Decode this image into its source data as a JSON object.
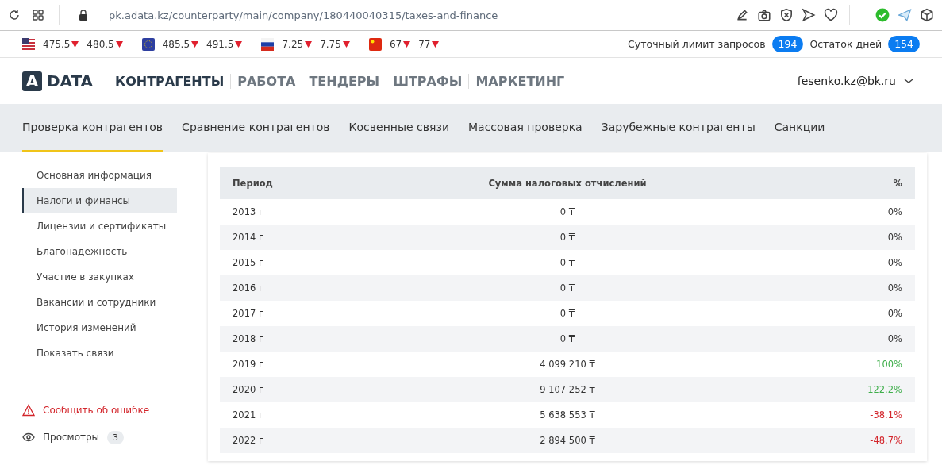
{
  "browser": {
    "url": "pk.adata.kz/counterparty/main/company/180440040315/taxes-and-finance"
  },
  "rates": [
    {
      "kind": "us",
      "values": [
        {
          "value": "475.5",
          "falling": true
        },
        {
          "value": "480.5",
          "falling": true
        }
      ]
    },
    {
      "kind": "eu",
      "values": [
        {
          "value": "485.5",
          "falling": true
        },
        {
          "value": "491.5",
          "falling": true
        }
      ]
    },
    {
      "kind": "ru",
      "values": [
        {
          "value": "7.25",
          "falling": true
        },
        {
          "value": "7.75",
          "falling": true
        }
      ]
    },
    {
      "kind": "cn",
      "values": [
        {
          "value": "67",
          "falling": true
        },
        {
          "value": "77",
          "falling": true
        }
      ]
    }
  ],
  "limits": [
    {
      "label": "Суточный лимит запросов",
      "count": "194"
    },
    {
      "label": "Остаток дней",
      "count": "154"
    }
  ],
  "logo": {
    "mark": "A",
    "text": "DATA"
  },
  "main_nav": [
    {
      "label": "КОНТРАГЕНТЫ",
      "selected": true
    },
    {
      "label": "РАБОТА",
      "selected": false
    },
    {
      "label": "ТЕНДЕРЫ",
      "selected": false
    },
    {
      "label": "ШТРАФЫ",
      "selected": false
    },
    {
      "label": "МАРКЕТИНГ",
      "selected": false
    }
  ],
  "user": {
    "email": "fesenko.kz@bk.ru"
  },
  "sub_nav": [
    {
      "label": "Проверка контрагентов",
      "selected": true
    },
    {
      "label": "Сравнение контрагентов",
      "selected": false
    },
    {
      "label": "Косвенные связи",
      "selected": false
    },
    {
      "label": "Массовая проверка",
      "selected": false
    },
    {
      "label": "Зарубежные контрагенты",
      "selected": false
    },
    {
      "label": "Санкции",
      "selected": false
    }
  ],
  "sidebar": {
    "items": [
      {
        "label": "Основная информация",
        "selected": false
      },
      {
        "label": "Налоги и финансы",
        "selected": true
      },
      {
        "label": "Лицензии и сертификаты",
        "selected": false
      },
      {
        "label": "Благонадежность",
        "selected": false
      },
      {
        "label": "Участие в закупках",
        "selected": false
      },
      {
        "label": "Вакансии и сотрудники",
        "selected": false
      },
      {
        "label": "История изменений",
        "selected": false
      },
      {
        "label": "Показать связи",
        "selected": false
      }
    ],
    "report_error": "Сообщить об ошибке",
    "views": {
      "label": "Просмотры",
      "count": "3"
    }
  },
  "table": {
    "columns": [
      "Период",
      "Сумма налоговых отчислений",
      "%"
    ],
    "rows": [
      {
        "period": "2013 г",
        "amount": "0 ₸",
        "percent": "0%",
        "growth": false,
        "decline": false
      },
      {
        "period": "2014 г",
        "amount": "0 ₸",
        "percent": "0%",
        "growth": false,
        "decline": false
      },
      {
        "period": "2015 г",
        "amount": "0 ₸",
        "percent": "0%",
        "growth": false,
        "decline": false
      },
      {
        "period": "2016 г",
        "amount": "0 ₸",
        "percent": "0%",
        "growth": false,
        "decline": false
      },
      {
        "period": "2017 г",
        "amount": "0 ₸",
        "percent": "0%",
        "growth": false,
        "decline": false
      },
      {
        "period": "2018 г",
        "amount": "0 ₸",
        "percent": "0%",
        "growth": false,
        "decline": false
      },
      {
        "period": "2019 г",
        "amount": "4 099 210 ₸",
        "percent": "100%",
        "growth": true,
        "decline": false
      },
      {
        "period": "2020 г",
        "amount": "9 107 252 ₸",
        "percent": "122.2%",
        "growth": true,
        "decline": false
      },
      {
        "period": "2021 г",
        "amount": "5 638 553 ₸",
        "percent": "-38.1%",
        "growth": false,
        "decline": true
      },
      {
        "period": "2022 г",
        "amount": "2 894 500 ₸",
        "percent": "-48.7%",
        "growth": false,
        "decline": true
      }
    ]
  }
}
